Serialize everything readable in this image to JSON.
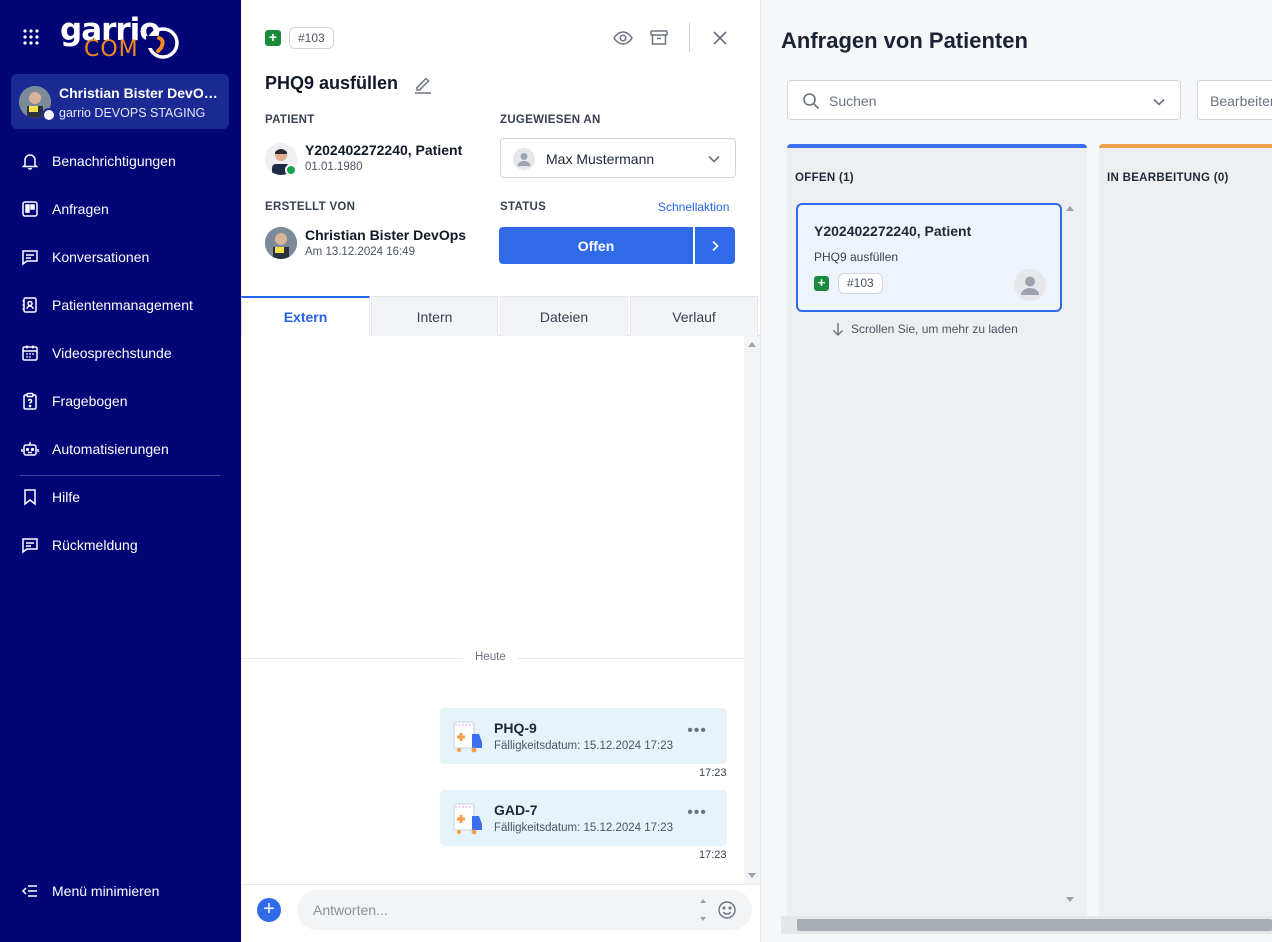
{
  "sidebar": {
    "logo": {
      "line1": "garrio",
      "line2": "COM"
    },
    "user": {
      "name": "Christian Bister DevOps",
      "org": "garrio DEVOPS STAGING"
    },
    "items": [
      {
        "label": "Benachrichtigungen",
        "icon": "bell-icon"
      },
      {
        "label": "Anfragen",
        "icon": "board-icon"
      },
      {
        "label": "Konversationen",
        "icon": "chat-icon"
      },
      {
        "label": "Patientenmanagement",
        "icon": "patient-card-icon"
      },
      {
        "label": "Videosprechstunde",
        "icon": "calendar-icon"
      },
      {
        "label": "Fragebogen",
        "icon": "clipboard-question-icon"
      },
      {
        "label": "Automatisierungen",
        "icon": "robot-icon"
      },
      {
        "label": "Hilfe",
        "icon": "bookmark-icon"
      },
      {
        "label": "Rückmeldung",
        "icon": "feedback-icon"
      }
    ],
    "minimize_label": "Menü minimieren"
  },
  "detail": {
    "ticket_id": "#103",
    "title": "PHQ9 ausfüllen",
    "patient_label": "PATIENT",
    "patient_name": "Y202402272240, Patient",
    "patient_dob": "01.01.1980",
    "assigned_label": "ZUGEWIESEN AN",
    "assigned_name": "Max Mustermann",
    "created_label": "ERSTELLT VON",
    "creator_name": "Christian Bister DevOps",
    "created_at": "Am 13.12.2024 16:49",
    "status_label": "STATUS",
    "quick_action": "Schnellaktion",
    "status_value": "Offen",
    "tabs": [
      "Extern",
      "Intern",
      "Dateien",
      "Verlauf"
    ],
    "day_separator": "Heute",
    "messages": [
      {
        "title": "PHQ-9",
        "due": "Fälligkeitsdatum: 15.12.2024 17:23",
        "time": "17:23"
      },
      {
        "title": "GAD-7",
        "due": "Fälligkeitsdatum: 15.12.2024 17:23",
        "time": "17:23"
      }
    ],
    "reply_placeholder": "Antworten..."
  },
  "board": {
    "title": "Anfragen von Patienten",
    "search_placeholder": "Suchen",
    "filter2_label": "Bearbeiter",
    "columns": [
      {
        "title": "OFFEN (1)",
        "color": "#3b6ff0"
      },
      {
        "title": "IN BEARBEITUNG (0)",
        "color": "#f0a04b"
      }
    ],
    "card": {
      "title": "Y202402272240, Patient",
      "subtitle": "PHQ9 ausfüllen",
      "ticket_id": "#103"
    },
    "load_more": "Scrollen Sie, um mehr zu laden"
  },
  "colors": {
    "sidebar": "#010575",
    "primary": "#2f6ae8",
    "success": "#1a8a3c",
    "accent_orange": "#f38a1d"
  }
}
